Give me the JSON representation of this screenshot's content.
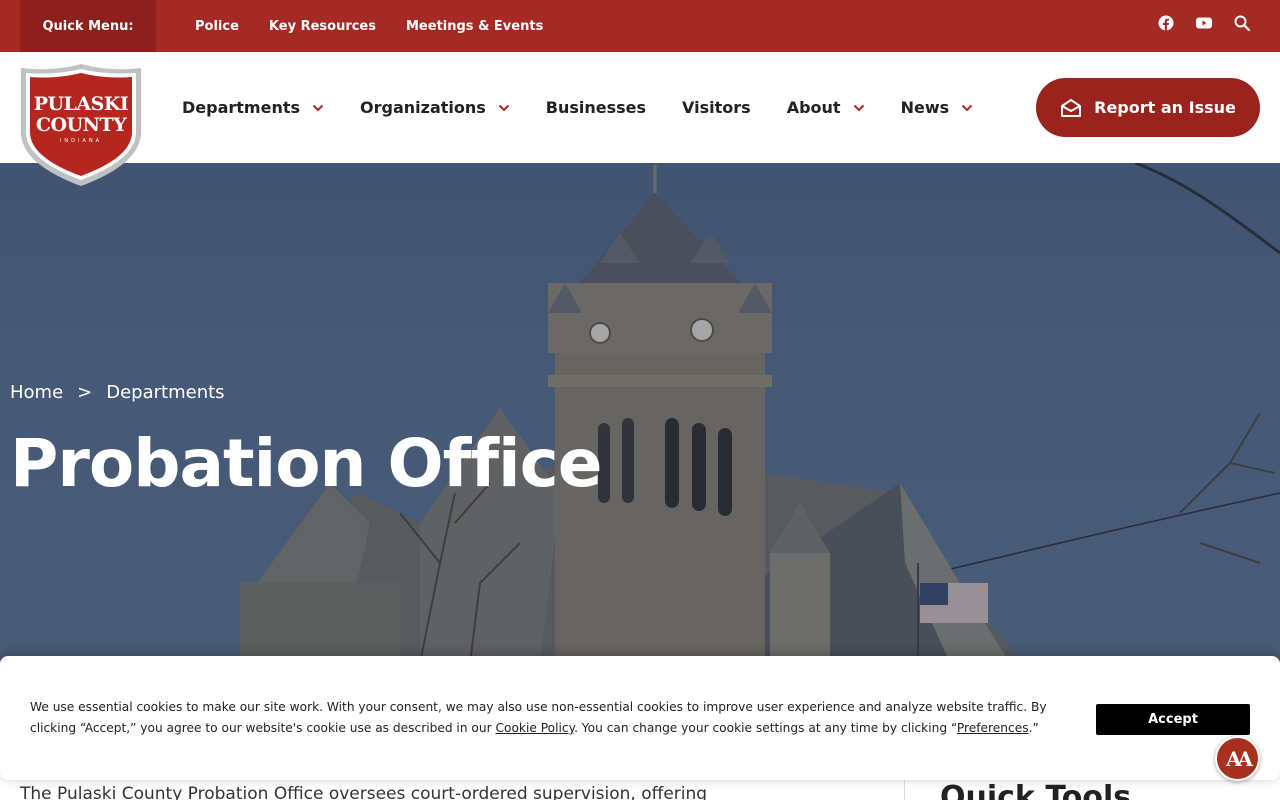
{
  "topbar": {
    "quick_menu_label": "Quick Menu:",
    "links": [
      "Police",
      "Key Resources",
      "Meetings & Events"
    ],
    "icons": [
      "facebook-icon",
      "youtube-icon",
      "search-icon"
    ]
  },
  "logo": {
    "line1": "PULASKI",
    "line2": "COUNTY",
    "line3": "INDIANA"
  },
  "nav": {
    "items": [
      {
        "label": "Departments",
        "has_dropdown": true
      },
      {
        "label": "Organizations",
        "has_dropdown": true
      },
      {
        "label": "Businesses",
        "has_dropdown": false
      },
      {
        "label": "Visitors",
        "has_dropdown": false
      },
      {
        "label": "About",
        "has_dropdown": true
      },
      {
        "label": "News",
        "has_dropdown": true
      }
    ],
    "report_button": "Report an Issue"
  },
  "hero": {
    "breadcrumb": [
      "Home",
      "Departments"
    ],
    "breadcrumb_sep": ">",
    "title": "Probation Office"
  },
  "content": {
    "intro": "The Pulaski County Probation Office oversees court-ordered supervision, offering",
    "sidebar_title": "Quick Tools"
  },
  "cookie": {
    "text_1": "We use essential cookies to make our site work. With your consent, we may also use non-essential cookies to improve user experience and analyze website traffic. By clicking “Accept,” you agree to our website's cookie use as described in our ",
    "cookie_policy_link": "Cookie Policy",
    "text_2": ". You can change your cookie settings at any time by clicking “",
    "preferences_link": "Preferences",
    "text_3": ".”",
    "accept_label": "Accept"
  },
  "accessibility_button": "AA",
  "colors": {
    "brand_red": "#a52a25",
    "brand_dark_red": "#8d201c",
    "button_red": "#9b231e",
    "accept_black": "#000000"
  }
}
